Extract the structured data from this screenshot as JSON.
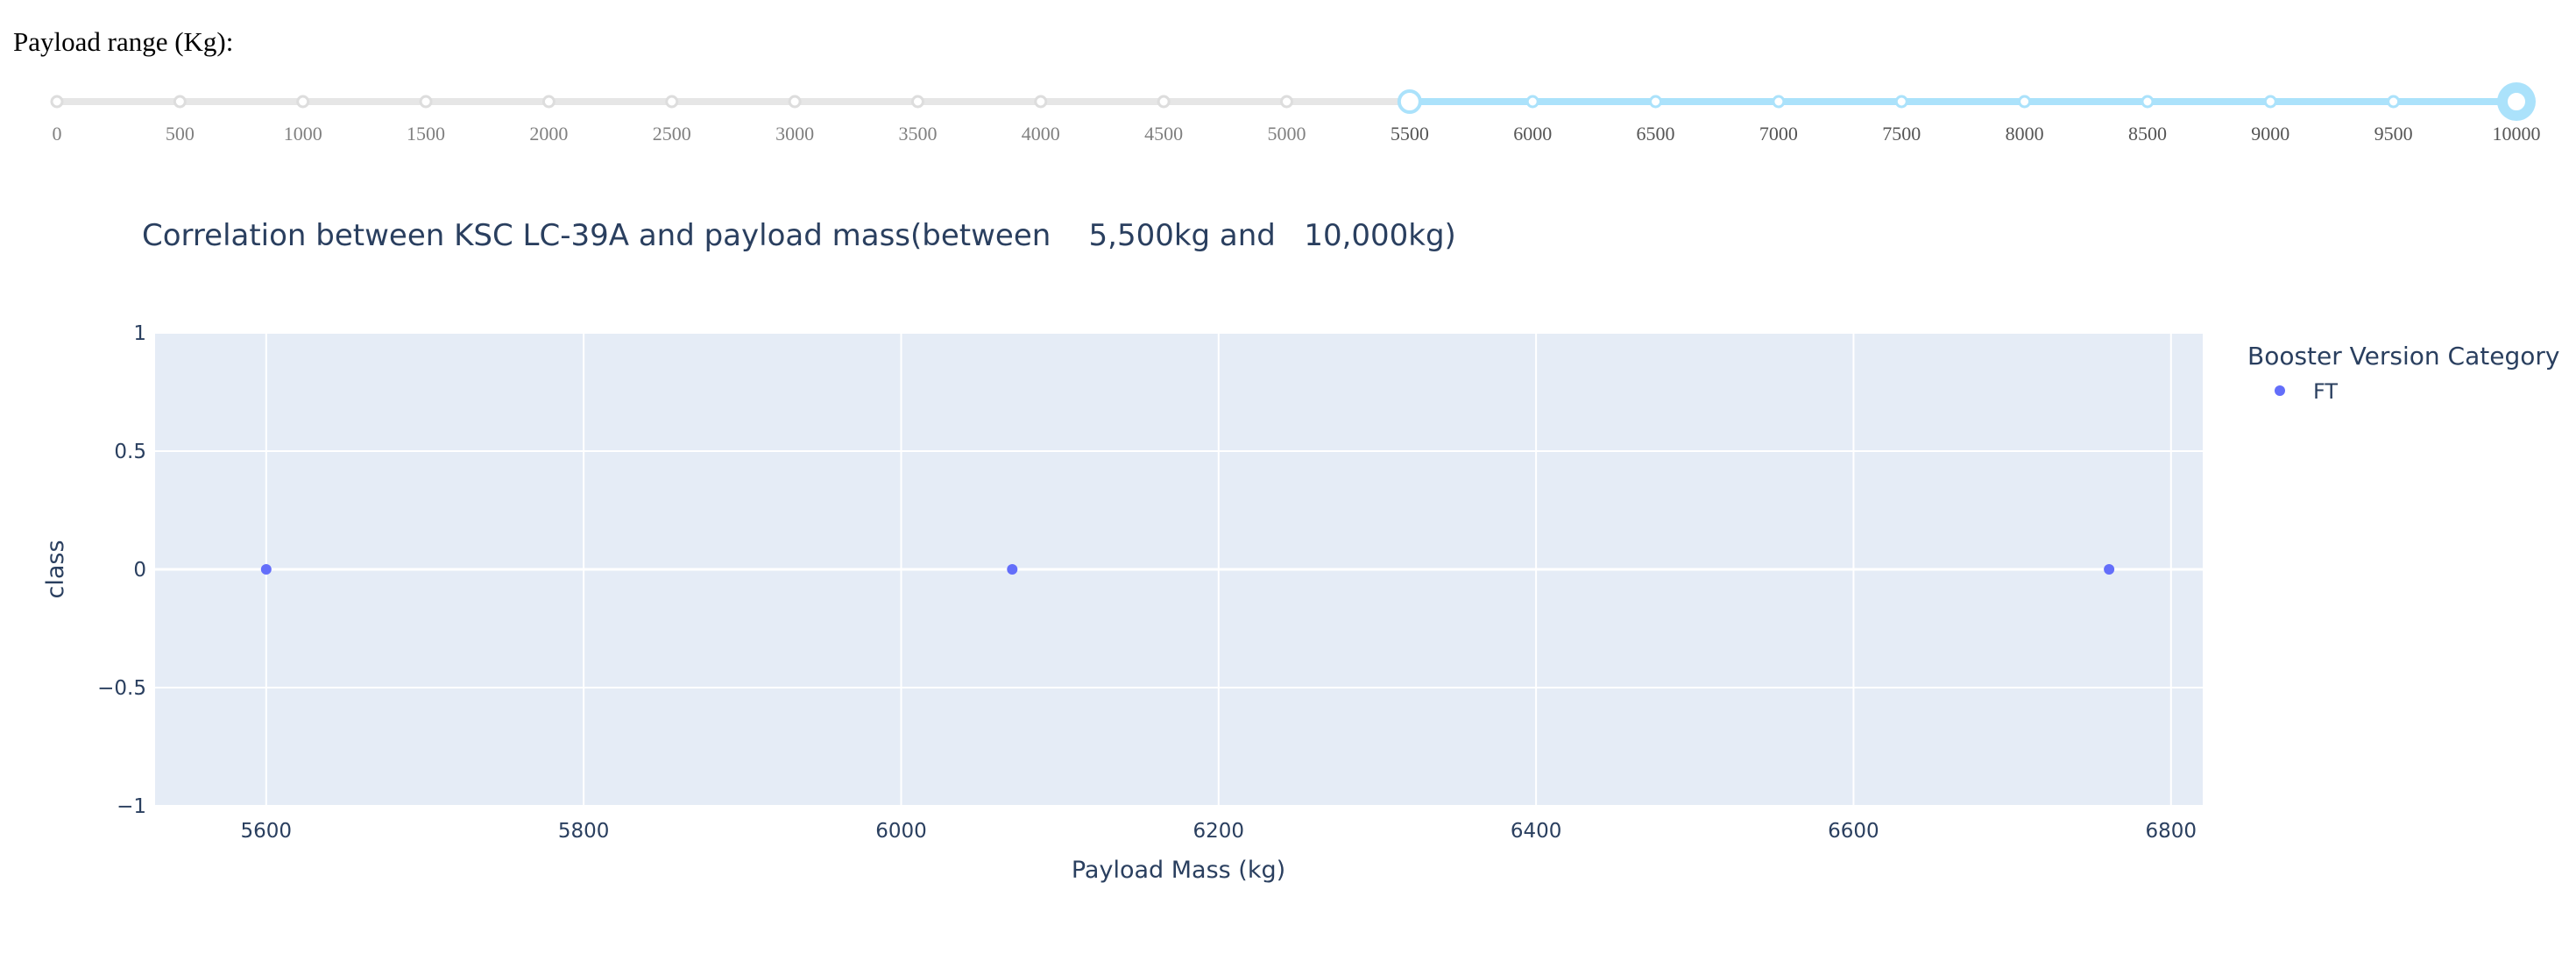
{
  "slider": {
    "label": "Payload range (Kg):",
    "min": 0,
    "max": 10000,
    "step": 500,
    "selected_low": 5500,
    "selected_high": 10000,
    "marks": [
      "0",
      "500",
      "1000",
      "1500",
      "2000",
      "2500",
      "3000",
      "3500",
      "4000",
      "4500",
      "5000",
      "5500",
      "6000",
      "6500",
      "7000",
      "7500",
      "8000",
      "8500",
      "9000",
      "9500",
      "10000"
    ],
    "track_color": "#e6e6e6",
    "active_color": "#abe2fb"
  },
  "chart_data": {
    "type": "scatter",
    "title": "Correlation between KSC LC-39A and payload mass(between    5,500kg and   10,000kg)",
    "xlabel": "Payload Mass (kg)",
    "ylabel": "class",
    "xlim": [
      5530,
      6820
    ],
    "ylim": [
      -1,
      1
    ],
    "x_ticks": [
      5600,
      5800,
      6000,
      6200,
      6400,
      6600,
      6800
    ],
    "y_ticks": [
      1,
      0.5,
      0,
      -0.5,
      -1
    ],
    "y_tick_labels": [
      "1",
      "0.5",
      "0",
      "−0.5",
      "−1"
    ],
    "legend_title": "Booster Version Category",
    "legend_position": "top-right",
    "grid": true,
    "plot_bg": "#e5ecf6",
    "series": [
      {
        "name": "FT",
        "color": "#636efa",
        "points": [
          {
            "x": 5600,
            "y": 0
          },
          {
            "x": 6070,
            "y": 0
          },
          {
            "x": 6761,
            "y": 0
          }
        ]
      }
    ]
  }
}
